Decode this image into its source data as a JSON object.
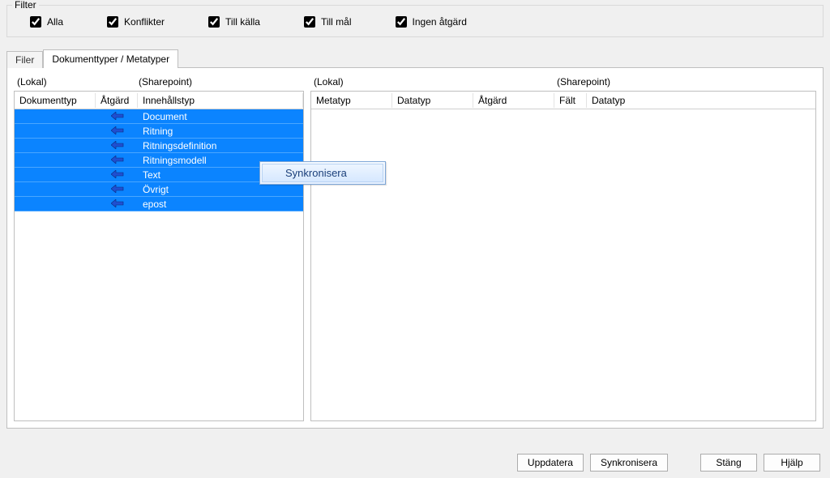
{
  "filter": {
    "title": "Filter",
    "items": [
      {
        "label": "Alla",
        "checked": true
      },
      {
        "label": "Konflikter",
        "checked": true
      },
      {
        "label": "Till källa",
        "checked": true
      },
      {
        "label": "Till mål",
        "checked": true
      },
      {
        "label": "Ingen åtgärd",
        "checked": true
      }
    ]
  },
  "tabs": {
    "inactive": "Filer",
    "active": "Dokumenttyper / Metatyper"
  },
  "leftPane": {
    "topLeft": "(Lokal)",
    "topRight": "(Sharepoint)",
    "columns": {
      "c0": "Dokumenttyp",
      "c1": "Åtgärd",
      "c2": "Innehållstyp"
    },
    "rows": [
      {
        "doctype": "",
        "action": "left-arrow",
        "content": "Document"
      },
      {
        "doctype": "",
        "action": "left-arrow",
        "content": "Ritning"
      },
      {
        "doctype": "",
        "action": "left-arrow",
        "content": "Ritningsdefinition"
      },
      {
        "doctype": "",
        "action": "left-arrow",
        "content": "Ritningsmodell"
      },
      {
        "doctype": "",
        "action": "left-arrow",
        "content": "Text"
      },
      {
        "doctype": "",
        "action": "left-arrow",
        "content": "Övrigt"
      },
      {
        "doctype": "",
        "action": "left-arrow",
        "content": "epost"
      }
    ]
  },
  "rightPane": {
    "topLeft": "(Lokal)",
    "topRight": "(Sharepoint)",
    "columns": {
      "c0": "Metatyp",
      "c1": "Datatyp",
      "c2": "Åtgärd",
      "c3": "Fält",
      "c4": "Datatyp"
    }
  },
  "contextMenu": {
    "item0": "Synkronisera"
  },
  "buttons": {
    "update": "Uppdatera",
    "sync": "Synkronisera",
    "close": "Stäng",
    "help": "Hjälp"
  },
  "colors": {
    "selection": "#0b84ff",
    "arrow": "#1f4fd1"
  }
}
